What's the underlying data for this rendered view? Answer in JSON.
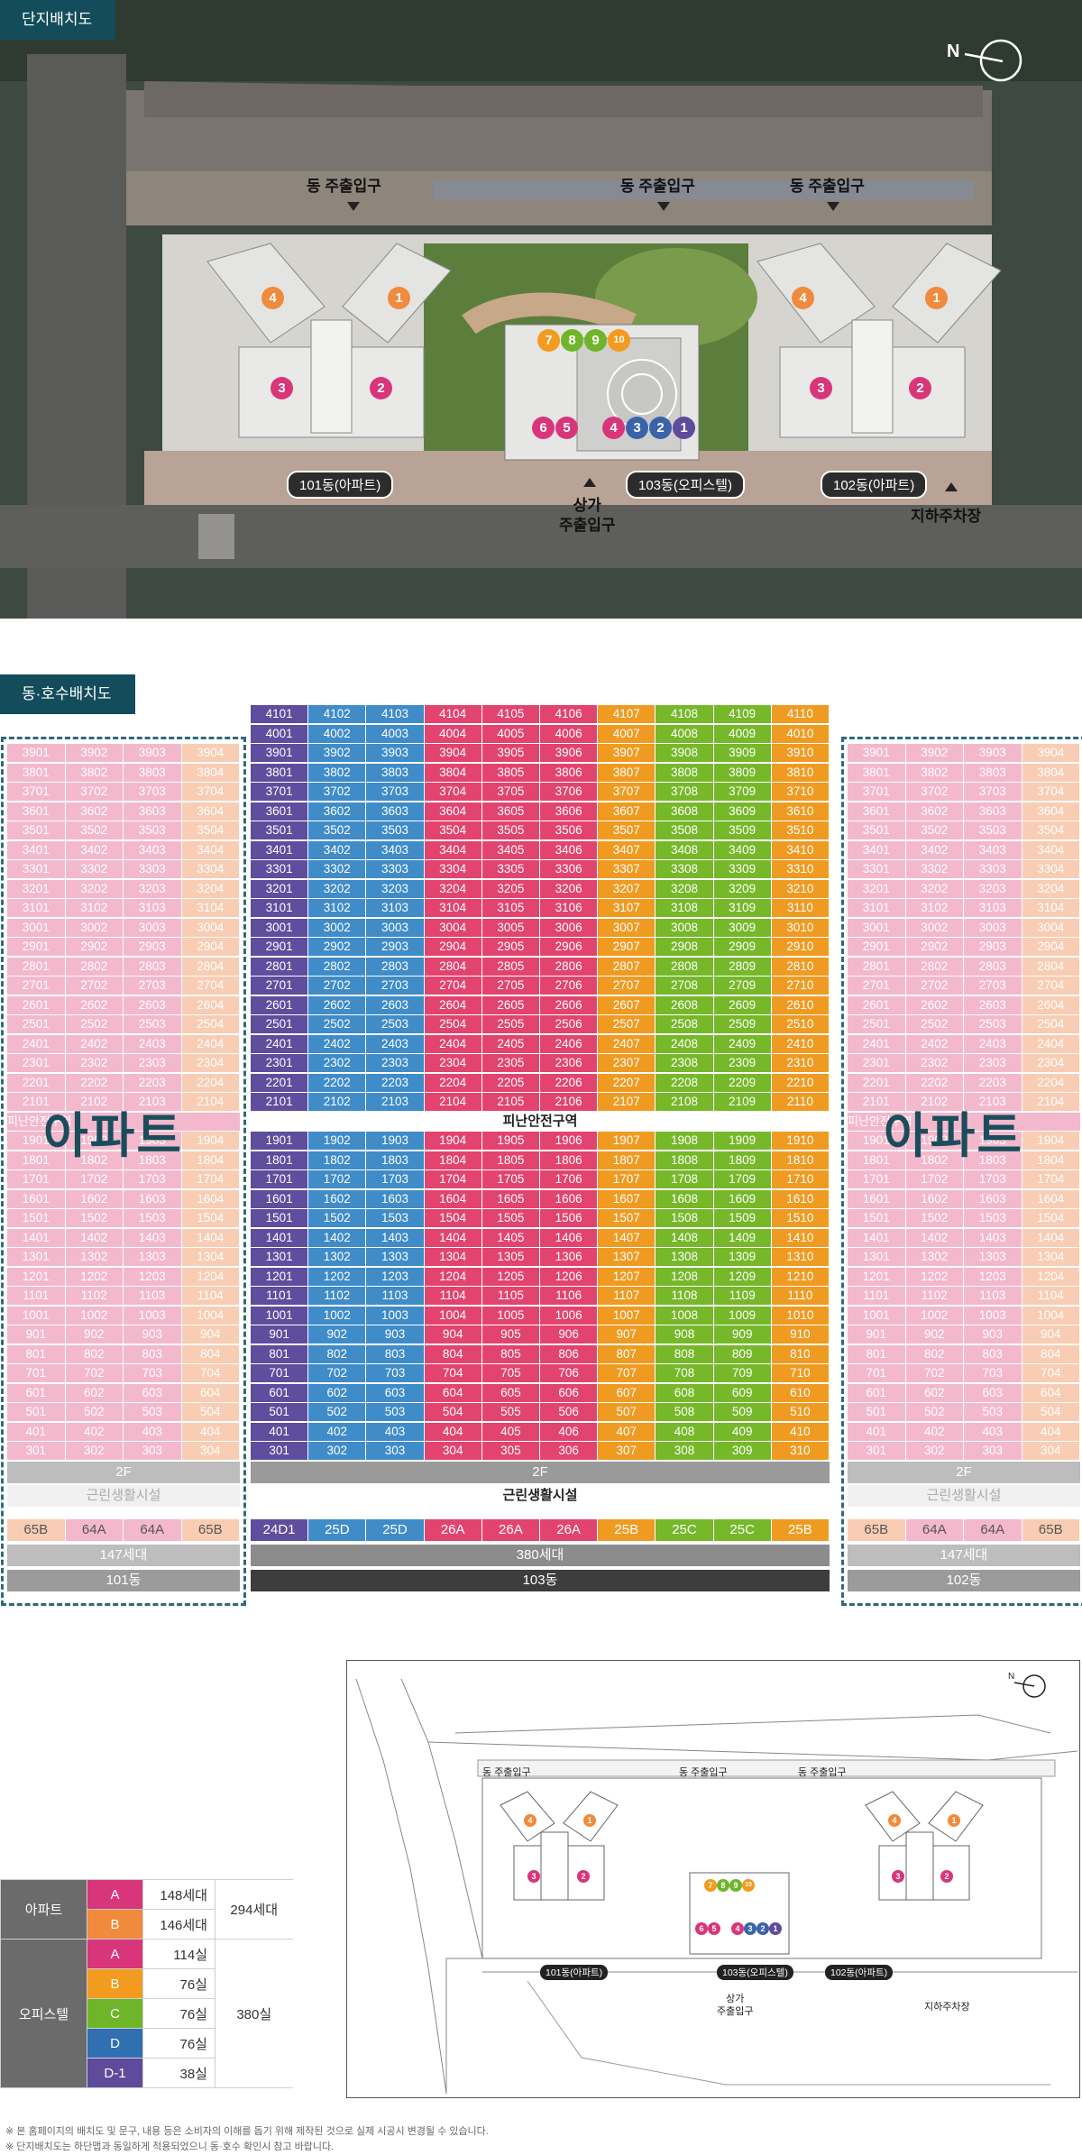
{
  "site_plan": {
    "tag": "단지배치도",
    "entrances": [
      "동 주출입구",
      "동 주출입구",
      "동 주출입구"
    ],
    "buildings": [
      "101동(아파트)",
      "103동(오피스텔)",
      "102동(아파트)"
    ],
    "shop_entrance": [
      "상가",
      "주출입구"
    ],
    "parking": "지하주차장",
    "north": "N"
  },
  "unit_plan": {
    "tag": "동·호수배치도",
    "apt_label": "아파트",
    "refuge": "피난안전구역",
    "floor_2f": "2F",
    "amenity": "근린생활시설",
    "b101": {
      "types": [
        "65B",
        "64A",
        "64A",
        "65B"
      ],
      "households": "147세대",
      "name": "101동"
    },
    "b102": {
      "types": [
        "65B",
        "64A",
        "64A",
        "65B"
      ],
      "households": "147세대",
      "name": "102동"
    },
    "b103": {
      "types": [
        "24D1",
        "25D",
        "25D",
        "26A",
        "26A",
        "26A",
        "25B",
        "25C",
        "25C",
        "25B"
      ],
      "households": "380세대",
      "name": "103동"
    },
    "floors_upper": [
      39,
      38,
      37,
      36,
      35,
      34,
      33,
      32,
      31,
      30,
      29,
      28,
      27,
      26,
      25,
      24,
      23,
      22,
      21
    ],
    "floors_lower": [
      19,
      18,
      17,
      16,
      15,
      14,
      13,
      12,
      11,
      10,
      9,
      8,
      7,
      6,
      5,
      4,
      3
    ],
    "top_floors_103": [
      41,
      40
    ],
    "colors": {
      "office_blue": "#3a63aa",
      "office_sky": "#3f8cc8",
      "office_pink": "#e2446f",
      "office_orange": "#ef9b22",
      "office_green": "#76b82a",
      "office_violet": "#5f4d9d",
      "apt_pink": "#f4b8cc",
      "apt_peach": "#f8cdb4"
    }
  },
  "summary": {
    "rows": [
      {
        "group": "아파트",
        "type": "A",
        "count": "148세대",
        "color": "#d9357a"
      },
      {
        "group": "아파트",
        "type": "B",
        "count": "146세대",
        "color": "#f08a3c"
      },
      {
        "group": "오피스텔",
        "type": "A",
        "count": "114실",
        "color": "#d9357a"
      },
      {
        "group": "오피스텔",
        "type": "B",
        "count": "76실",
        "color": "#f29b1f"
      },
      {
        "group": "오피스텔",
        "type": "C",
        "count": "76실",
        "color": "#6fb52a"
      },
      {
        "group": "오피스텔",
        "type": "D",
        "count": "76실",
        "color": "#2f6fb2"
      },
      {
        "group": "오피스텔",
        "type": "D-1",
        "count": "38실",
        "color": "#5e4b9b"
      }
    ],
    "apt_total": "294세대",
    "office_total": "380실"
  },
  "notes": [
    "※ 본 홈페이지의 배치도 및 문구, 내용 등은 소비자의 이해를 돕기 위해 제작된 것으로 실제 시공시 변경될 수 있습니다.",
    "※ 단지배치도는 하단맵과 동일하게 적용되었으니 동·호수 확인시 참고 바랍니다."
  ]
}
